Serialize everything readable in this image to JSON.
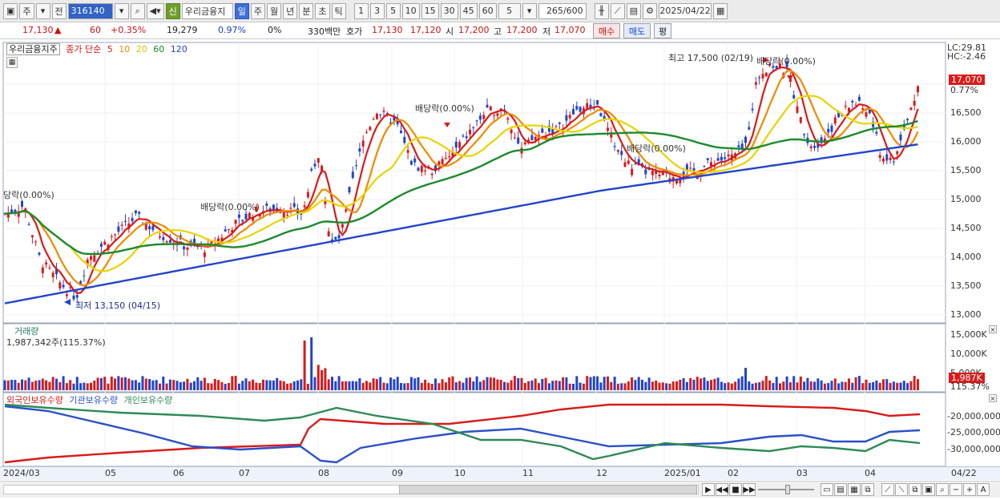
{
  "toolbar": {
    "interval": "주",
    "prev": "전",
    "code": "316140",
    "name": "우리금융지",
    "new_badge": "신",
    "periods": [
      "일",
      "주",
      "월",
      "년",
      "분",
      "초",
      "틱"
    ],
    "selected_period": "일",
    "minutes": [
      "1",
      "3",
      "5",
      "10",
      "15",
      "30",
      "45",
      "60"
    ],
    "minute_value": "5",
    "count": "265",
    "count_total": "/600",
    "date": "2025/04/22"
  },
  "quote": {
    "price": "17,130",
    "change_arrow": "▲",
    "change": "60",
    "change_pct": "+0.35%",
    "volume": "19,279",
    "vol_pct": "0.97%",
    "zero_pct": "0%",
    "amount": "330백만",
    "hoga_label": "호가",
    "ask": "17,130",
    "bid": "17,120",
    "open_label": "시",
    "open": "17,200",
    "high_label": "고",
    "high": "17,200",
    "low_label": "저",
    "low": "17,070",
    "buy": "매수",
    "sell": "매도",
    "avg": "평"
  },
  "price_panel": {
    "name": "우리금융지주",
    "ma_title": "종가 단순",
    "ma_periods": [
      "5",
      "10",
      "20",
      "60",
      "120"
    ],
    "ma_colors": [
      "#d81b1b",
      "#ef8a00",
      "#e8d400",
      "#1c8a2c",
      "#2244cc"
    ],
    "lc": "LC:29.81",
    "hc": "HC:-2.46",
    "last_price": "17,070",
    "last_pct": "0.77%",
    "high_note": "최고 17,500 (02/19)",
    "low_note": "최저 13,150 (04/15)",
    "div_label": "배당락(0.00%)",
    "div_label_short": "당락(0.00%)",
    "y_ticks": [
      "17,000",
      "16,500",
      "16,000",
      "15,500",
      "15,000",
      "14,500",
      "14,000",
      "13,500",
      "13,000"
    ]
  },
  "volume_panel": {
    "title": "거래량",
    "value": "1,987,342주(115.37%)",
    "y_ticks": [
      "15,000K",
      "10,000K",
      "5,000K"
    ],
    "last_value": "1,987K",
    "last_pct": "115.37%"
  },
  "holdings_panel": {
    "titles": [
      "외국인보유수량",
      "기관보유수량",
      "개인보유수량"
    ],
    "colors": [
      "#d81b1b",
      "#2a50c8",
      "#2e8a55"
    ],
    "y_ticks": [
      "-20,000,000",
      "-25,000,000",
      "-30,000,000"
    ]
  },
  "x_axis": {
    "labels": [
      "2024/03",
      "05",
      "06",
      "07",
      "08",
      "09",
      "10",
      "11",
      "12",
      "2025/01",
      "02",
      "03",
      "04"
    ],
    "last_date": "04/22"
  }
}
